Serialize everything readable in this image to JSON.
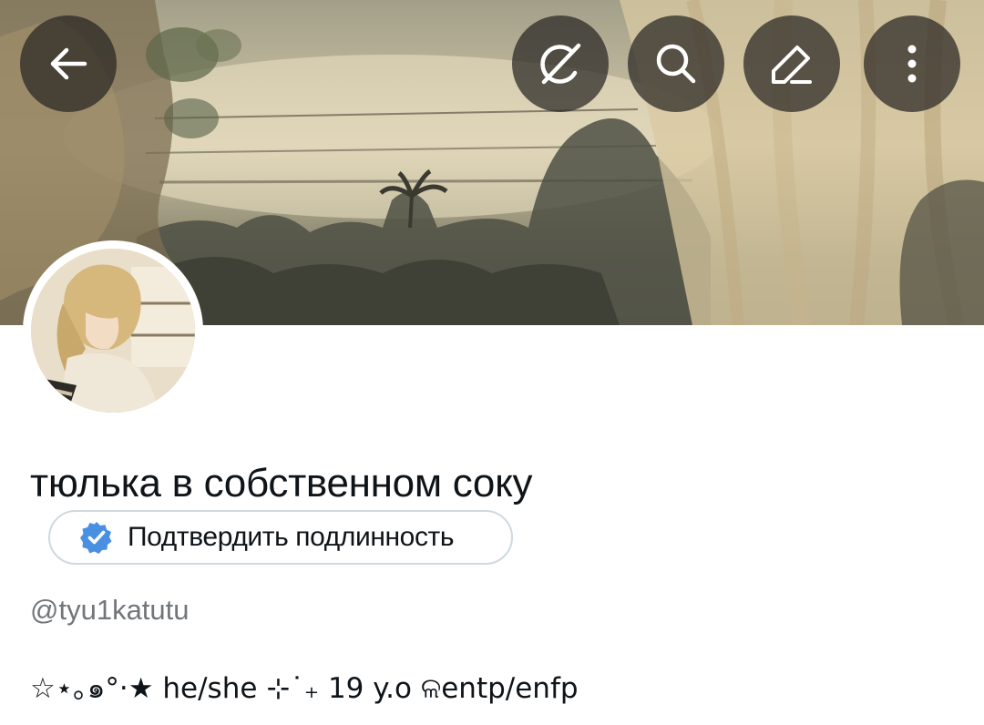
{
  "header": {
    "back_icon": "arrow-left-icon",
    "actions": [
      {
        "icon": "grok-icon"
      },
      {
        "icon": "search-icon"
      },
      {
        "icon": "edit-pen-icon"
      },
      {
        "icon": "more-vertical-icon"
      }
    ]
  },
  "profile": {
    "display_name": "тюлька в собственном соку",
    "verify_button_label": "Подтвердить подлинность",
    "handle": "@tyu1katutu",
    "bio": "☆⋆｡๑°·★ he/she ⊹˙₊ 19 y.o ଳentp/enfp"
  },
  "colors": {
    "verify_badge": "#4a90e2",
    "handle_text": "#71767b",
    "primary_text": "#0f1419",
    "button_border": "#cfd9de"
  }
}
